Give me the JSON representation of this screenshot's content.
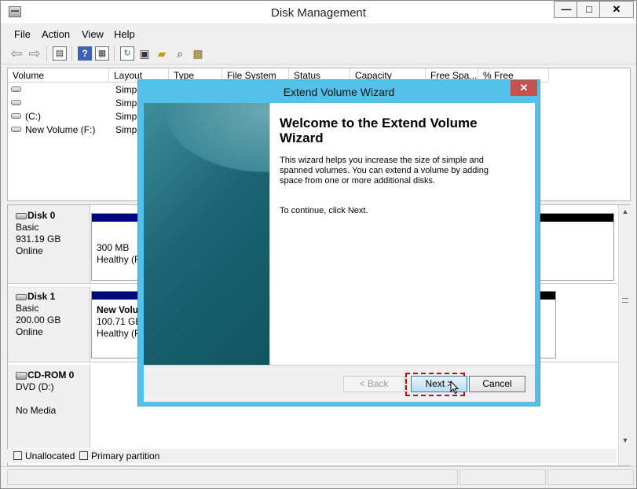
{
  "window": {
    "title": "Disk Management",
    "controls": {
      "minimize": "—",
      "maximize": "□",
      "close": "✕"
    }
  },
  "menu": [
    "File",
    "Action",
    "View",
    "Help"
  ],
  "toolbar": {
    "icons": [
      "back-arrow-icon",
      "forward-arrow-icon",
      "properties-icon",
      "help-icon",
      "console-icon",
      "refresh-icon",
      "rescan-icon",
      "open-folder-icon",
      "search-icon",
      "export-icon"
    ]
  },
  "volume_list": {
    "columns": [
      "Volume",
      "Layout",
      "Type",
      "File System",
      "Status",
      "Capacity",
      "Free Spa...",
      "% Free"
    ],
    "rows": [
      {
        "volume": "",
        "layout": "Simpl"
      },
      {
        "volume": "",
        "layout": "Simpl"
      },
      {
        "volume": "(C:)",
        "layout": "Simpl"
      },
      {
        "volume": "New Volume (F:)",
        "layout": "Simpl"
      }
    ]
  },
  "disks": [
    {
      "name": "Disk 0",
      "type": "Basic",
      "size": "931.19 GB",
      "state": "Online",
      "partition": {
        "size": "300 MB",
        "status": "Healthy (R"
      }
    },
    {
      "name": "Disk 1",
      "type": "Basic",
      "size": "200.00 GB",
      "state": "Online",
      "partition": {
        "name": "New Volu",
        "size": "100.71 GB",
        "status": "Healthy (P"
      }
    },
    {
      "name": "CD-ROM 0",
      "type": "DVD (D:)",
      "size": "",
      "state": "No Media"
    }
  ],
  "legend": [
    {
      "label": "Unallocated",
      "color": "#000000"
    },
    {
      "label": "Primary partition",
      "color": "#00087d"
    }
  ],
  "wizard": {
    "title": "Extend Volume Wizard",
    "heading": "Welcome to the Extend Volume Wizard",
    "body": "This wizard helps you increase the size of simple and spanned volumes. You can extend a volume  by adding space from one or more additional disks.",
    "continue_text": "To continue, click Next.",
    "buttons": {
      "back": "< Back",
      "next": "Next >",
      "cancel": "Cancel"
    },
    "close": "✕"
  }
}
